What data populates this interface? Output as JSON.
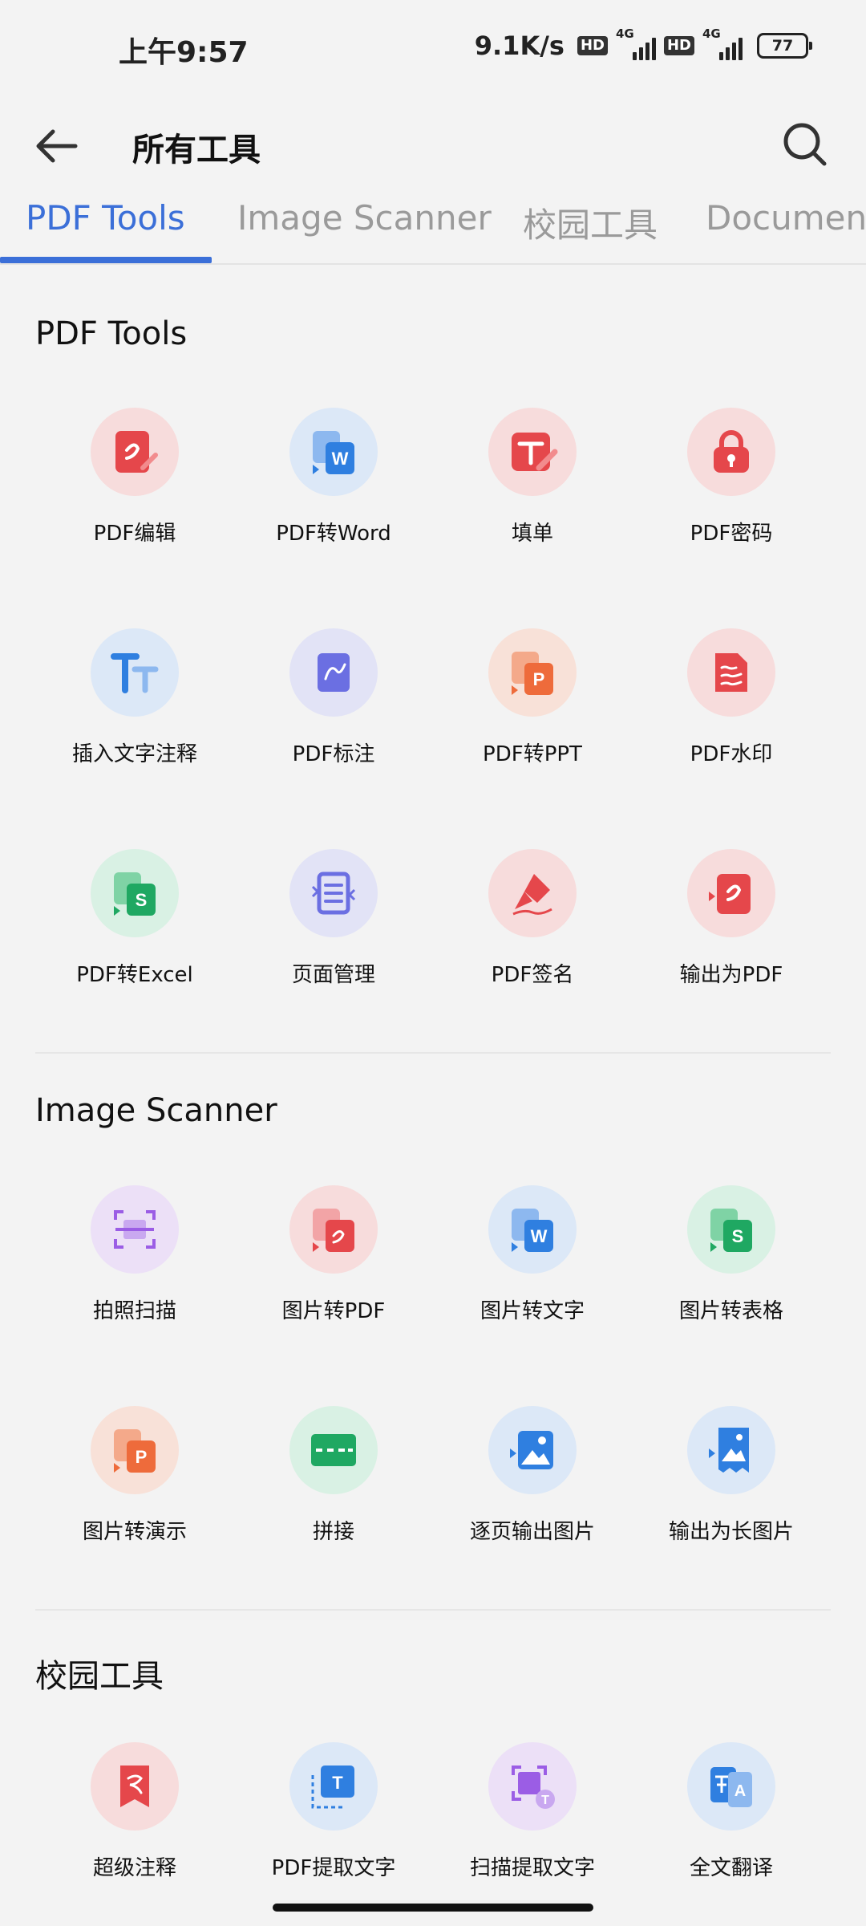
{
  "status": {
    "time": "上午9:57",
    "net_speed": "9.1K/s",
    "hd1": "HD",
    "hd2": "HD",
    "sig1": "4G",
    "sig2": "4G",
    "battery": "77"
  },
  "header": {
    "title": "所有工具"
  },
  "tabs": [
    "PDF Tools",
    "Image Scanner",
    "校园工具",
    "Document"
  ],
  "sections": {
    "pdf": {
      "title": "PDF Tools",
      "items": [
        {
          "label": "PDF编辑",
          "icon": "pdf-edit-icon"
        },
        {
          "label": "PDF转Word",
          "icon": "pdf-to-word-icon"
        },
        {
          "label": "填单",
          "icon": "fill-form-icon"
        },
        {
          "label": "PDF密码",
          "icon": "lock-icon"
        },
        {
          "label": "插入文字注释",
          "icon": "text-annotation-icon"
        },
        {
          "label": "PDF标注",
          "icon": "pdf-markup-icon"
        },
        {
          "label": "PDF转PPT",
          "icon": "pdf-to-ppt-icon"
        },
        {
          "label": "PDF水印",
          "icon": "watermark-icon"
        },
        {
          "label": "PDF转Excel",
          "icon": "pdf-to-excel-icon"
        },
        {
          "label": "页面管理",
          "icon": "page-manage-icon"
        },
        {
          "label": "PDF签名",
          "icon": "signature-pen-icon"
        },
        {
          "label": "输出为PDF",
          "icon": "export-pdf-icon"
        }
      ]
    },
    "scanner": {
      "title": "Image Scanner",
      "items": [
        {
          "label": "拍照扫描",
          "icon": "scan-icon"
        },
        {
          "label": "图片转PDF",
          "icon": "image-to-pdf-icon"
        },
        {
          "label": "图片转文字",
          "icon": "image-to-text-icon"
        },
        {
          "label": "图片转表格",
          "icon": "image-to-sheet-icon"
        },
        {
          "label": "图片转演示",
          "icon": "image-to-slides-icon"
        },
        {
          "label": "拼接",
          "icon": "stitch-icon"
        },
        {
          "label": "逐页输出图片",
          "icon": "export-pages-image-icon"
        },
        {
          "label": "输出为长图片",
          "icon": "export-long-image-icon"
        }
      ]
    },
    "campus": {
      "title": "校园工具",
      "items": [
        {
          "label": "超级注释",
          "icon": "super-note-icon"
        },
        {
          "label": "PDF提取文字",
          "icon": "pdf-extract-text-icon"
        },
        {
          "label": "扫描提取文字",
          "icon": "scan-extract-text-icon"
        },
        {
          "label": "全文翻译",
          "icon": "translate-icon"
        }
      ]
    }
  }
}
